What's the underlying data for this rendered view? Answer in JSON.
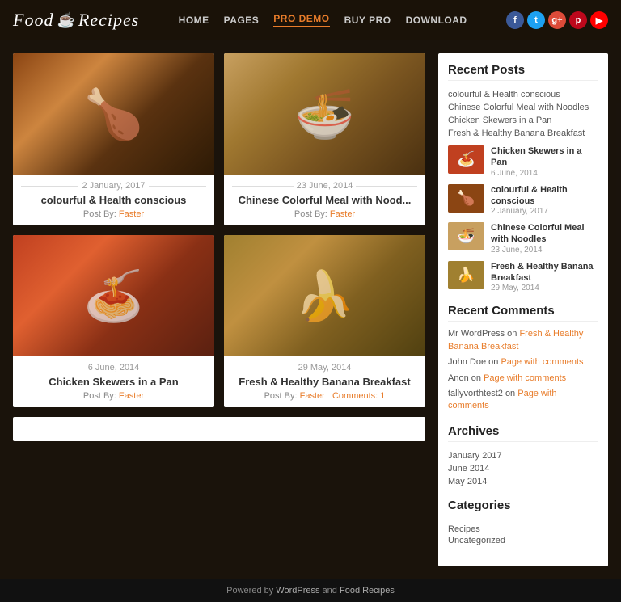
{
  "header": {
    "logo_text_1": "Food",
    "logo_text_2": "Recipes",
    "logo_icon": "☕",
    "nav_items": [
      {
        "label": "HOME",
        "active": false
      },
      {
        "label": "PAGES",
        "active": false
      },
      {
        "label": "PRO DEMO",
        "active": true
      },
      {
        "label": "BUY PRO",
        "active": false
      },
      {
        "label": "DOWNLOAD",
        "active": false
      }
    ],
    "social": [
      {
        "label": "f",
        "class": "si-fb"
      },
      {
        "label": "t",
        "class": "si-tw"
      },
      {
        "label": "g+",
        "class": "si-gp"
      },
      {
        "label": "p",
        "class": "si-pi"
      },
      {
        "label": "▶",
        "class": "si-yt"
      }
    ]
  },
  "posts": [
    {
      "date": "2 January, 2017",
      "title": "colourful & Health conscious",
      "post_by": "Post By:",
      "author": "Faster",
      "img_class": "food-fried",
      "emoji": "🍗"
    },
    {
      "date": "23 June, 2014",
      "title": "Chinese Colorful Meal with Nood...",
      "post_by": "Post By:",
      "author": "Faster",
      "img_class": "food-noodles",
      "emoji": "🍜"
    },
    {
      "date": "6 June, 2014",
      "title": "Chicken Skewers in a Pan",
      "post_by": "Post By:",
      "author": "Faster",
      "img_class": "food-pasta",
      "emoji": "🍝"
    },
    {
      "date": "29 May, 2014",
      "title": "Fresh & Healthy Banana Breakfast",
      "post_by": "Post By:",
      "author": "Faster",
      "comments": "Comments: 1",
      "img_class": "food-banana",
      "emoji": "🍌"
    }
  ],
  "sidebar": {
    "recent_posts_title": "Recent Posts",
    "recent_links": [
      "colourful & Health conscious",
      "Chinese Colorful Meal with Noodles",
      "Chicken Skewers in a Pan",
      "Fresh & Healthy Banana Breakfast"
    ],
    "recent_thumb": [
      {
        "title": "Chicken Skewers in a Pan",
        "date": "6 June, 2014",
        "emoji": "🍝",
        "bg": "#c04020"
      },
      {
        "title": "colourful & Health conscious",
        "date": "2 January, 2017",
        "emoji": "🍗",
        "bg": "#8B4513"
      },
      {
        "title": "Chinese Colorful Meal with Noodles",
        "date": "23 June, 2014",
        "emoji": "🍜",
        "bg": "#c8a060"
      },
      {
        "title": "Fresh & Healthy Banana Breakfast",
        "date": "29 May, 2014",
        "emoji": "🍌",
        "bg": "#a08030"
      }
    ],
    "recent_comments_title": "Recent Comments",
    "comments": [
      {
        "user": "Mr WordPress",
        "on": "on",
        "link": "Fresh & Healthy Banana Breakfast"
      },
      {
        "user": "John Doe",
        "on": "on",
        "link": "Page with comments"
      },
      {
        "user": "Anon",
        "on": "on",
        "link": "Page with comments"
      },
      {
        "user": "tallyvorthtest2",
        "on": "on",
        "link": "Page with comments"
      }
    ],
    "archives_title": "Archives",
    "archives": [
      "January 2017",
      "June 2014",
      "May 2014"
    ],
    "categories_title": "Categories",
    "categories": [
      "Recipes",
      "Uncategorized"
    ]
  },
  "footer": {
    "text": "Powered by ",
    "link1": "WordPress",
    "mid": " and ",
    "link2": "Food Recipes"
  }
}
